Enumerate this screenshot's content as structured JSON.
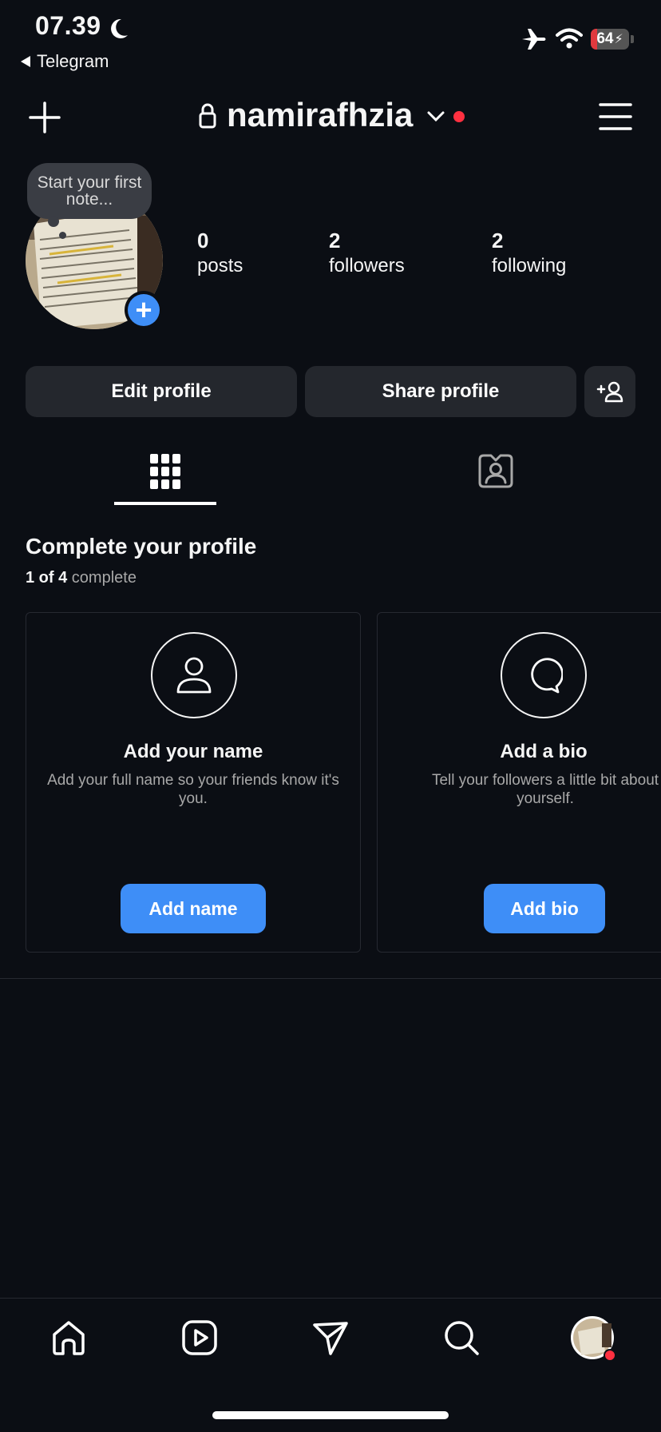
{
  "status_bar": {
    "time": "07.39",
    "back_app": "Telegram",
    "battery": "64",
    "icons": [
      "moon-icon",
      "airplane-icon",
      "wifi-icon",
      "battery-icon"
    ]
  },
  "header": {
    "username": "namirafhzia",
    "icons": [
      "plus-icon",
      "lock-icon",
      "chevron-down-icon",
      "menu-icon"
    ]
  },
  "profile": {
    "note_placeholder": "Start your first note...",
    "stats": [
      {
        "value": "0",
        "label": "posts"
      },
      {
        "value": "2",
        "label": "followers"
      },
      {
        "value": "2",
        "label": "following"
      }
    ]
  },
  "actions": {
    "edit_profile": "Edit profile",
    "share_profile": "Share profile",
    "discover_people_icon": "add-person-icon"
  },
  "tabs": [
    {
      "icon": "grid-icon",
      "active": true
    },
    {
      "icon": "tagged-icon",
      "active": false
    }
  ],
  "complete_profile": {
    "title": "Complete your profile",
    "progress_done": "1 of 4",
    "progress_suffix": " complete",
    "cards": [
      {
        "icon": "person-icon",
        "title": "Add your name",
        "description": "Add your full name so your friends know it's you.",
        "button": "Add name"
      },
      {
        "icon": "chat-bubble-icon",
        "title": "Add a bio",
        "description": "Tell your followers a little bit about yourself.",
        "button": "Add bio"
      }
    ]
  },
  "bottom_nav": [
    "home-icon",
    "reels-icon",
    "send-icon",
    "search-icon",
    "profile-avatar"
  ],
  "colors": {
    "background": "#0b0e14",
    "accent": "#3e8ef7",
    "button_bg": "#24272d",
    "notification": "#ff3040"
  }
}
